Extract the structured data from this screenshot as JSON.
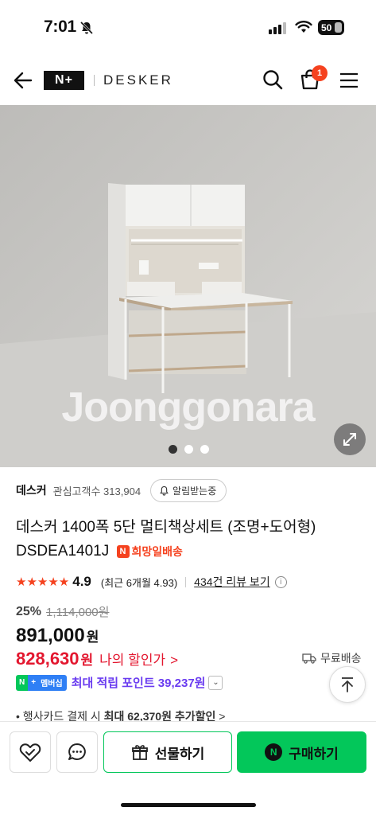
{
  "status_bar": {
    "time": "7:01",
    "battery": "50",
    "icons": [
      "bell-slash-icon",
      "signal-icon",
      "wifi-icon",
      "battery-icon"
    ]
  },
  "header": {
    "logo": "N+",
    "brand": "DESKER",
    "cart_count": "1",
    "icons": [
      "back-arrow-icon",
      "search-icon",
      "cart-icon",
      "hamburger-menu-icon"
    ]
  },
  "hero": {
    "watermark": "Joonggonara",
    "slides": 3,
    "active_slide": 1
  },
  "store": {
    "name": "데스커",
    "watchers": "관심고객수 313,904",
    "alarm_label": "알림받는중"
  },
  "product": {
    "title": "데스커 1400폭 5단 멀티책상세트 (조명+도어형) DSDEA1401J",
    "tag": "희망일배송"
  },
  "rating": {
    "stars": "★★★★★",
    "score": "4.9",
    "recent": "(최근 6개월 4.93)",
    "reviews": "434건 리뷰 보기"
  },
  "pricing": {
    "discount_pct": "25%",
    "original_price": "1,114,000원",
    "price": "891,000",
    "currency": "원",
    "my_price": "828,630",
    "my_price_label": "나의 할인가",
    "shipping": "무료배송"
  },
  "points": {
    "badge_n": "N",
    "badge_plus": "+",
    "badge_member": "멤버십",
    "text": "최대 적립 포인트 39,237원"
  },
  "card_line": {
    "prefix": "• 행사카드 결제 시 ",
    "bold": "최대 62,370원 추가할인",
    "suffix": " >"
  },
  "bottom": {
    "gift_label": "선물하기",
    "buy_label": "구매하기"
  },
  "colors": {
    "naver_green": "#03c75a",
    "sale_red": "#e3172f",
    "points_purple": "#6a3cf0",
    "accent_orange": "#f5421f"
  }
}
